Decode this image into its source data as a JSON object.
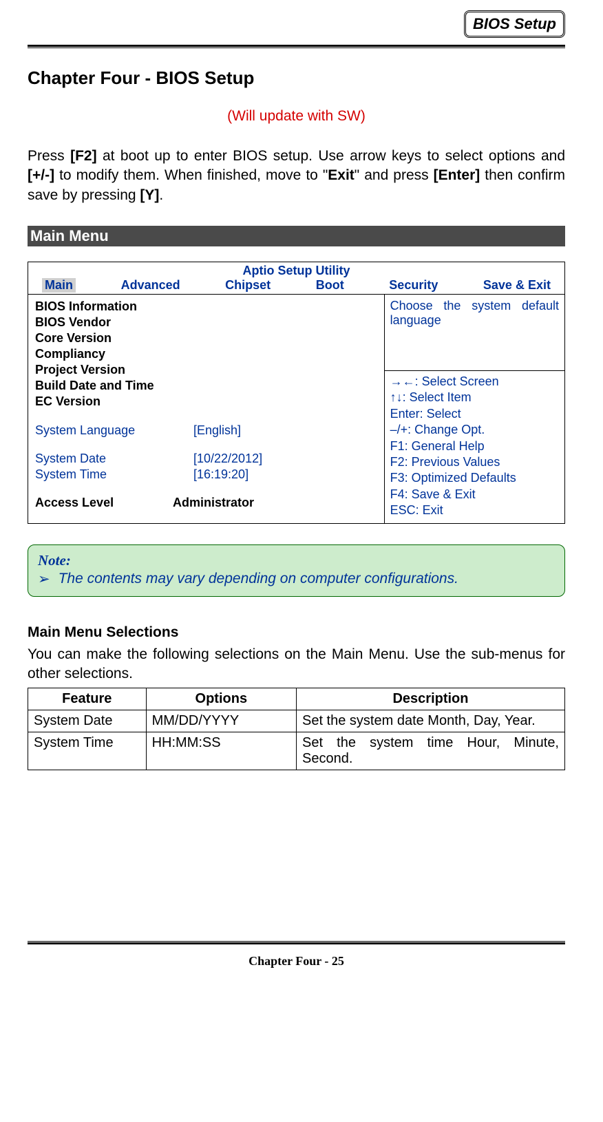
{
  "header": {
    "badge": "BIOS Setup"
  },
  "chapter": {
    "title": "Chapter Four - BIOS Setup",
    "update_note": "(Will update with SW)",
    "intro_html": "Press [F2] at boot up to enter BIOS setup. Use arrow keys to select options and [+/-] to modify them. When finished, move to \"Exit\" and press [Enter] then confirm save by pressing [Y]."
  },
  "section": {
    "main_menu": "Main Menu"
  },
  "bios": {
    "utility_title": "Aptio Setup Utility",
    "tabs": {
      "main": "Main",
      "advanced": "Advanced",
      "chipset": "Chipset",
      "boot": "Boot",
      "security": "Security",
      "save_exit": "Save & Exit"
    },
    "info_lines": {
      "l1": "BIOS Information",
      "l2": "BIOS Vendor",
      "l3": "Core Version",
      "l4": "Compliancy",
      "l5": "Project Version",
      "l6": "Build Date and Time",
      "l7": "EC Version"
    },
    "fields": {
      "language_label": "System Language",
      "language_value": "[English]",
      "date_label": "System Date",
      "date_value": "[10/22/2012]",
      "time_label": "System Time",
      "time_value": "[16:19:20]",
      "access_label": "Access Level",
      "access_value": "Administrator"
    },
    "help_text": "Choose the system default language",
    "keys": {
      "k1": "→←: Select Screen",
      "k2": "↑↓: Select Item",
      "k3": "Enter: Select",
      "k4": "–/+: Change Opt.",
      "k5": "F1: General Help",
      "k6": "F2: Previous Values",
      "k7": "F3: Optimized Defaults",
      "k8": "F4: Save & Exit",
      "k9": "ESC: Exit"
    }
  },
  "note": {
    "title": "Note:",
    "arrow": "➢",
    "text": "The contents may vary depending on computer configurations."
  },
  "selections": {
    "heading": "Main Menu Selections",
    "intro": "You can make the following selections on the Main Menu. Use the sub-menus for other selections.",
    "headers": {
      "feature": "Feature",
      "options": "Options",
      "description": "Description"
    },
    "rows": {
      "r1": {
        "feature": "System Date",
        "options": "MM/DD/YYYY",
        "description": "Set the system date Month, Day, Year."
      },
      "r2": {
        "feature": "System Time",
        "options": "HH:MM:SS",
        "description": "Set the system time Hour, Minute, Second."
      }
    }
  },
  "footer": {
    "text": "Chapter Four - 25"
  }
}
